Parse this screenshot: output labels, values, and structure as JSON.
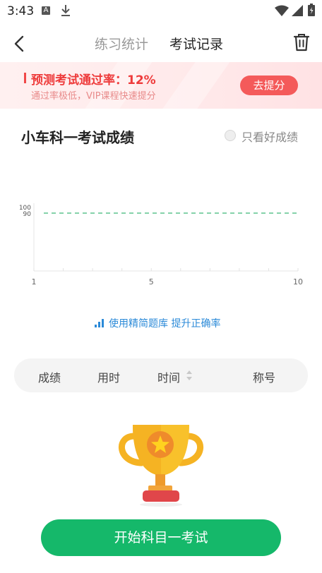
{
  "status_bar": {
    "time": "3:43",
    "notification_icon": "A"
  },
  "nav": {
    "tab_stats": "练习统计",
    "tab_records": "考试记录"
  },
  "promo": {
    "title": "预测考试通过率：12%",
    "subtitle": "通过率极低，VIP课程快速提分",
    "button": "去提分"
  },
  "section": {
    "title": "小车科一考试成绩",
    "filter_label": "只看好成绩",
    "filter_checked": false
  },
  "chart_data": {
    "type": "line",
    "title": "",
    "series": [],
    "x_ticks": [
      "1",
      "5",
      "10"
    ],
    "xlim": [
      1,
      10
    ],
    "y_ticks": [
      "100",
      "90"
    ],
    "reference_line": {
      "y": 90,
      "style": "dashed",
      "color": "#3cb878"
    }
  },
  "tip": {
    "text": "使用精简题库 提升正确率"
  },
  "table": {
    "headers": [
      "成绩",
      "用时",
      "时间",
      "称号"
    ]
  },
  "cta": {
    "label": "开始科目一考试"
  },
  "colors": {
    "accent": "#15b86a",
    "promo_red": "#f04848",
    "link_blue": "#2b8ad8"
  }
}
